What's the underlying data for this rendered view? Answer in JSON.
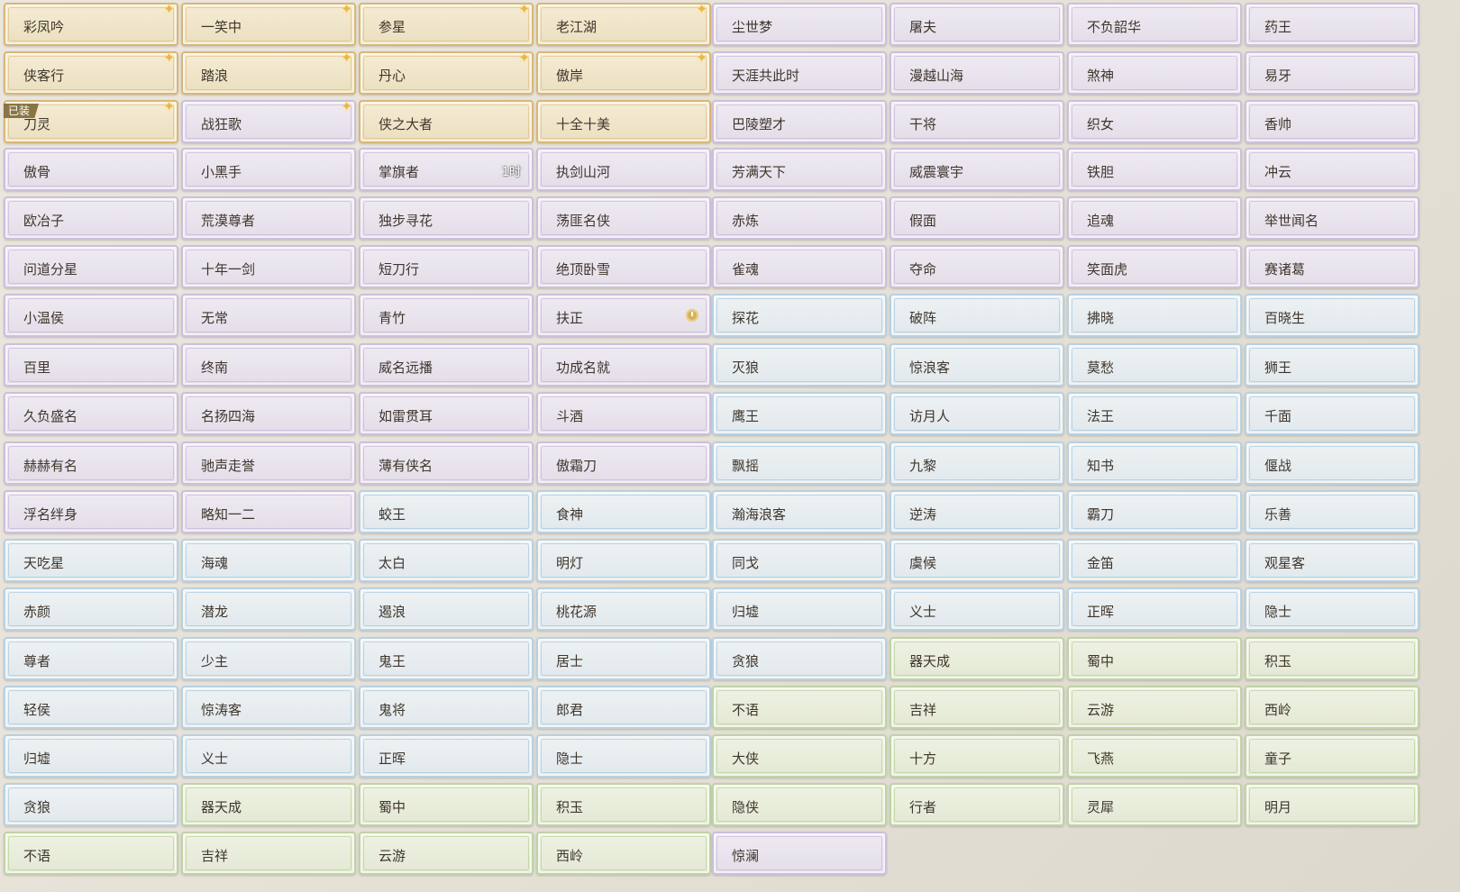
{
  "colors": {
    "gold": "#d9b774",
    "purple": "#cdbfdc",
    "blue": "#b8d1e2",
    "green": "#bfd3a6",
    "text": "#3f362c"
  },
  "columns": [
    {
      "cards": [
        {
          "label": "彩凤吟",
          "tier": "gold",
          "star": true
        },
        {
          "label": "侠客行",
          "tier": "gold",
          "star": true
        },
        {
          "label": "刀灵",
          "tier": "gold",
          "star": true,
          "badge": "已装"
        },
        {
          "label": "傲骨",
          "tier": "purple"
        },
        {
          "label": "欧冶子",
          "tier": "purple"
        },
        {
          "label": "问道分星",
          "tier": "purple"
        },
        {
          "label": "小温侯",
          "tier": "purple"
        },
        {
          "label": "百里",
          "tier": "purple"
        },
        {
          "label": "久负盛名",
          "tier": "purple"
        },
        {
          "label": "赫赫有名",
          "tier": "purple"
        },
        {
          "label": "浮名绊身",
          "tier": "purple"
        },
        {
          "label": "天吃星",
          "tier": "blue"
        },
        {
          "label": "赤颜",
          "tier": "blue"
        },
        {
          "label": "尊者",
          "tier": "blue"
        },
        {
          "label": "轻侯",
          "tier": "blue"
        },
        {
          "label": "归墟",
          "tier": "blue"
        },
        {
          "label": "贪狼",
          "tier": "blue"
        },
        {
          "label": "不语",
          "tier": "green"
        }
      ]
    },
    {
      "cards": [
        {
          "label": "一笑中",
          "tier": "gold",
          "star": true
        },
        {
          "label": "踏浪",
          "tier": "gold",
          "star": true
        },
        {
          "label": "战狂歌",
          "tier": "purple",
          "star": true
        },
        {
          "label": "小黑手",
          "tier": "purple"
        },
        {
          "label": "荒漠尊者",
          "tier": "purple"
        },
        {
          "label": "十年一剑",
          "tier": "purple"
        },
        {
          "label": "无常",
          "tier": "purple"
        },
        {
          "label": "终南",
          "tier": "purple"
        },
        {
          "label": "名扬四海",
          "tier": "purple"
        },
        {
          "label": "驰声走誉",
          "tier": "purple"
        },
        {
          "label": "略知一二",
          "tier": "purple"
        },
        {
          "label": "海魂",
          "tier": "blue"
        },
        {
          "label": "潜龙",
          "tier": "blue"
        },
        {
          "label": "少主",
          "tier": "blue"
        },
        {
          "label": "惊涛客",
          "tier": "blue"
        },
        {
          "label": "义士",
          "tier": "blue"
        },
        {
          "label": "器天成",
          "tier": "green"
        },
        {
          "label": "吉祥",
          "tier": "green"
        }
      ]
    },
    {
      "cards": [
        {
          "label": "参星",
          "tier": "gold",
          "star": true
        },
        {
          "label": "丹心",
          "tier": "gold",
          "star": true
        },
        {
          "label": "侠之大者",
          "tier": "gold"
        },
        {
          "label": "掌旗者",
          "tier": "purple",
          "timer": "1时"
        },
        {
          "label": "独步寻花",
          "tier": "purple"
        },
        {
          "label": "短刀行",
          "tier": "purple"
        },
        {
          "label": "青竹",
          "tier": "purple"
        },
        {
          "label": "威名远播",
          "tier": "purple"
        },
        {
          "label": "如雷贯耳",
          "tier": "purple"
        },
        {
          "label": "薄有侠名",
          "tier": "purple"
        },
        {
          "label": "蛟王",
          "tier": "blue"
        },
        {
          "label": "太白",
          "tier": "blue"
        },
        {
          "label": "遏浪",
          "tier": "blue"
        },
        {
          "label": "鬼王",
          "tier": "blue"
        },
        {
          "label": "鬼将",
          "tier": "blue"
        },
        {
          "label": "正晖",
          "tier": "blue"
        },
        {
          "label": "蜀中",
          "tier": "green"
        },
        {
          "label": "云游",
          "tier": "green"
        }
      ]
    },
    {
      "cards": [
        {
          "label": "老江湖",
          "tier": "gold",
          "star": true
        },
        {
          "label": "傲岸",
          "tier": "gold",
          "star": true
        },
        {
          "label": "十全十美",
          "tier": "gold"
        },
        {
          "label": "执剑山河",
          "tier": "purple"
        },
        {
          "label": "荡匪名侠",
          "tier": "purple"
        },
        {
          "label": "绝顶卧雪",
          "tier": "purple"
        },
        {
          "label": "扶正",
          "tier": "purple",
          "clock": true
        },
        {
          "label": "功成名就",
          "tier": "purple"
        },
        {
          "label": "斗酒",
          "tier": "purple"
        },
        {
          "label": "傲霜刀",
          "tier": "purple"
        },
        {
          "label": "食神",
          "tier": "blue"
        },
        {
          "label": "明灯",
          "tier": "blue"
        },
        {
          "label": "桃花源",
          "tier": "blue"
        },
        {
          "label": "居士",
          "tier": "blue"
        },
        {
          "label": "郎君",
          "tier": "blue"
        },
        {
          "label": "隐士",
          "tier": "blue"
        },
        {
          "label": "积玉",
          "tier": "green"
        },
        {
          "label": "西岭",
          "tier": "green"
        }
      ]
    },
    {
      "cards": [
        {
          "label": "尘世梦",
          "tier": "purple"
        },
        {
          "label": "天涯共此时",
          "tier": "purple"
        },
        {
          "label": "巴陵塑才",
          "tier": "purple"
        },
        {
          "label": "芳满天下",
          "tier": "purple"
        },
        {
          "label": "赤炼",
          "tier": "purple"
        },
        {
          "label": "雀魂",
          "tier": "purple"
        },
        {
          "label": "探花",
          "tier": "blue"
        },
        {
          "label": "灭狼",
          "tier": "blue"
        },
        {
          "label": "鹰王",
          "tier": "blue"
        },
        {
          "label": "飘摇",
          "tier": "blue"
        },
        {
          "label": "瀚海浪客",
          "tier": "blue"
        },
        {
          "label": "同戈",
          "tier": "blue"
        },
        {
          "label": "归墟",
          "tier": "blue"
        },
        {
          "label": "贪狼",
          "tier": "blue"
        },
        {
          "label": "不语",
          "tier": "green"
        },
        {
          "label": "大侠",
          "tier": "green"
        },
        {
          "label": "隐侠",
          "tier": "green"
        },
        {
          "label": "惊澜",
          "tier": "purple"
        }
      ]
    },
    {
      "cards": [
        {
          "label": "屠夫",
          "tier": "purple"
        },
        {
          "label": "漫越山海",
          "tier": "purple"
        },
        {
          "label": "干将",
          "tier": "purple"
        },
        {
          "label": "威震寰宇",
          "tier": "purple"
        },
        {
          "label": "假面",
          "tier": "purple"
        },
        {
          "label": "夺命",
          "tier": "purple"
        },
        {
          "label": "破阵",
          "tier": "blue"
        },
        {
          "label": "惊浪客",
          "tier": "blue"
        },
        {
          "label": "访月人",
          "tier": "blue"
        },
        {
          "label": "九黎",
          "tier": "blue"
        },
        {
          "label": "逆涛",
          "tier": "blue"
        },
        {
          "label": "虞候",
          "tier": "blue"
        },
        {
          "label": "义士",
          "tier": "blue"
        },
        {
          "label": "器天成",
          "tier": "green"
        },
        {
          "label": "吉祥",
          "tier": "green"
        },
        {
          "label": "十方",
          "tier": "green"
        },
        {
          "label": "行者",
          "tier": "green"
        }
      ]
    },
    {
      "cards": [
        {
          "label": "不负韶华",
          "tier": "purple"
        },
        {
          "label": "煞神",
          "tier": "purple"
        },
        {
          "label": "织女",
          "tier": "purple"
        },
        {
          "label": "铁胆",
          "tier": "purple"
        },
        {
          "label": "追魂",
          "tier": "purple"
        },
        {
          "label": "笑面虎",
          "tier": "purple"
        },
        {
          "label": "拂晓",
          "tier": "blue"
        },
        {
          "label": "莫愁",
          "tier": "blue"
        },
        {
          "label": "法王",
          "tier": "blue"
        },
        {
          "label": "知书",
          "tier": "blue"
        },
        {
          "label": "霸刀",
          "tier": "blue"
        },
        {
          "label": "金笛",
          "tier": "blue"
        },
        {
          "label": "正晖",
          "tier": "blue"
        },
        {
          "label": "蜀中",
          "tier": "green"
        },
        {
          "label": "云游",
          "tier": "green"
        },
        {
          "label": "飞燕",
          "tier": "green"
        },
        {
          "label": "灵犀",
          "tier": "green"
        }
      ]
    },
    {
      "cards": [
        {
          "label": "药王",
          "tier": "purple"
        },
        {
          "label": "易牙",
          "tier": "purple"
        },
        {
          "label": "香帅",
          "tier": "purple"
        },
        {
          "label": "冲云",
          "tier": "purple"
        },
        {
          "label": "举世闻名",
          "tier": "purple"
        },
        {
          "label": "赛诸葛",
          "tier": "purple"
        },
        {
          "label": "百晓生",
          "tier": "blue"
        },
        {
          "label": "狮王",
          "tier": "blue"
        },
        {
          "label": "千面",
          "tier": "blue"
        },
        {
          "label": "偃战",
          "tier": "blue"
        },
        {
          "label": "乐善",
          "tier": "blue"
        },
        {
          "label": "观星客",
          "tier": "blue"
        },
        {
          "label": "隐士",
          "tier": "blue"
        },
        {
          "label": "积玉",
          "tier": "green"
        },
        {
          "label": "西岭",
          "tier": "green"
        },
        {
          "label": "童子",
          "tier": "green"
        },
        {
          "label": "明月",
          "tier": "green"
        }
      ]
    }
  ]
}
